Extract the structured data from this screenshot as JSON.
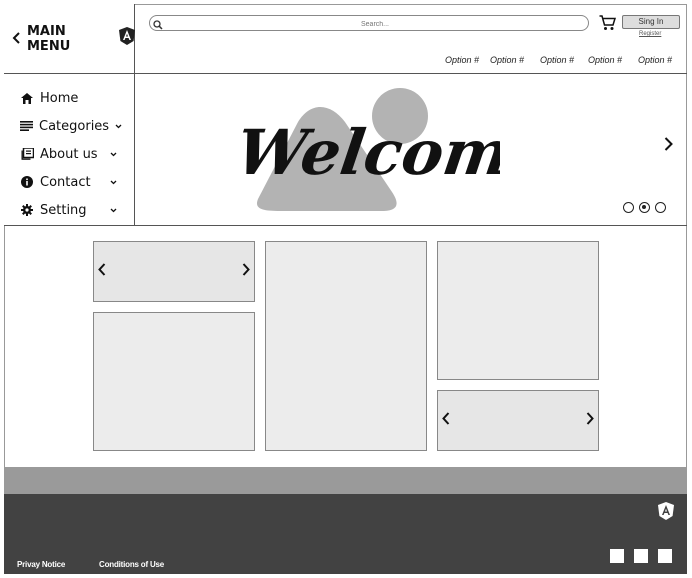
{
  "sidebar": {
    "title": "MAIN MENU",
    "items": [
      {
        "label": "Home",
        "icon": "home-icon",
        "has_chevron": false
      },
      {
        "label": "Categories",
        "icon": "list-icon",
        "has_chevron": true
      },
      {
        "label": "About us",
        "icon": "book-icon",
        "has_chevron": true
      },
      {
        "label": "Contact",
        "icon": "info-icon",
        "has_chevron": true
      },
      {
        "label": "Setting",
        "icon": "gear-icon",
        "has_chevron": true
      }
    ]
  },
  "header": {
    "search_placeholder": "Search...",
    "signin_label": "Sing In",
    "register_label": "Register",
    "options": [
      "Option #",
      "Option #",
      "Option #",
      "Option #",
      "Option #"
    ]
  },
  "hero": {
    "welcome_text": "Welcome",
    "slides": 3,
    "active_slide": 2
  },
  "footer": {
    "links": [
      "Privay Notice",
      "Conditions of Use"
    ]
  },
  "colors": {
    "footer_dark": "#424242",
    "footer_band": "#9a9a9a",
    "card_bg": "#ececec"
  }
}
